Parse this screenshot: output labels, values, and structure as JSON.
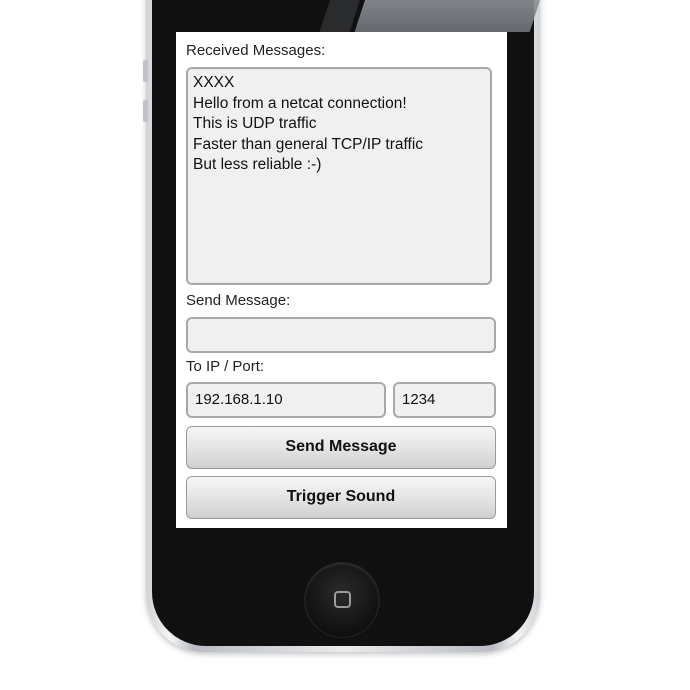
{
  "received": {
    "label": "Received Messages:",
    "lines": [
      "XXXX",
      "Hello from a netcat connection!",
      "This is UDP traffic",
      "Faster than general TCP/IP traffic",
      "But less reliable :-)"
    ]
  },
  "send": {
    "label": "Send Message:",
    "value": "",
    "placeholder": ""
  },
  "target": {
    "label": "To IP / Port:",
    "ip": "192.168.1.10",
    "port": "1234"
  },
  "buttons": {
    "send_message": "Send Message",
    "trigger_sound": "Trigger Sound"
  },
  "icons": {
    "home_button": "home-button-icon"
  }
}
